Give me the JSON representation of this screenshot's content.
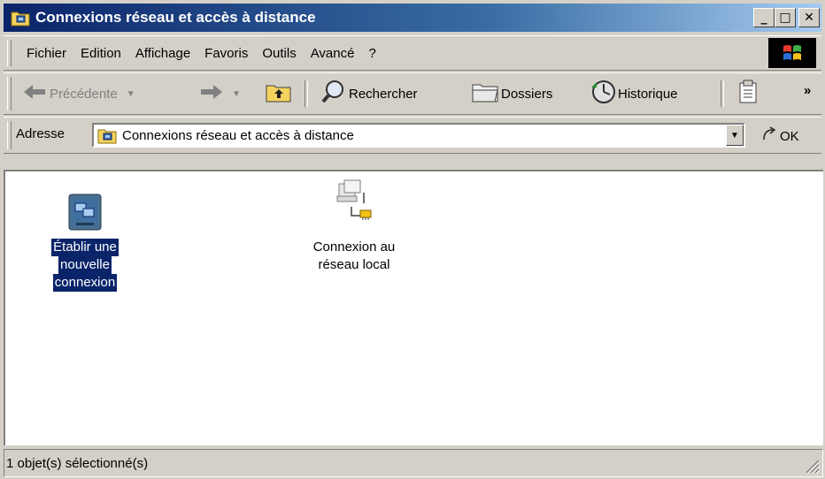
{
  "window": {
    "title": "Connexions réseau et accès à distance",
    "buttons": {
      "minimize": "_",
      "maximize": "□",
      "close": "✕"
    }
  },
  "menubar": {
    "items": [
      "Fichier",
      "Edition",
      "Affichage",
      "Favoris",
      "Outils",
      "Avancé",
      "?"
    ]
  },
  "toolbar": {
    "back_label": "Précédente",
    "search_label": "Rechercher",
    "folders_label": "Dossiers",
    "history_label": "Historique",
    "more_glyph": "»"
  },
  "address": {
    "label": "Adresse",
    "value": "Connexions réseau et accès à distance",
    "go_label": "OK"
  },
  "content": {
    "items": [
      {
        "line1": "Établir une",
        "line2": "nouvelle",
        "line3": "connexion",
        "selected": true
      },
      {
        "line1": "Connexion au",
        "line2": "réseau local",
        "selected": false
      }
    ]
  },
  "status": {
    "text": "1 objet(s) sélectionné(s)"
  },
  "colors": {
    "title_active": "#0a246a",
    "selection": "#0a246a",
    "face": "#d4d0c8"
  }
}
